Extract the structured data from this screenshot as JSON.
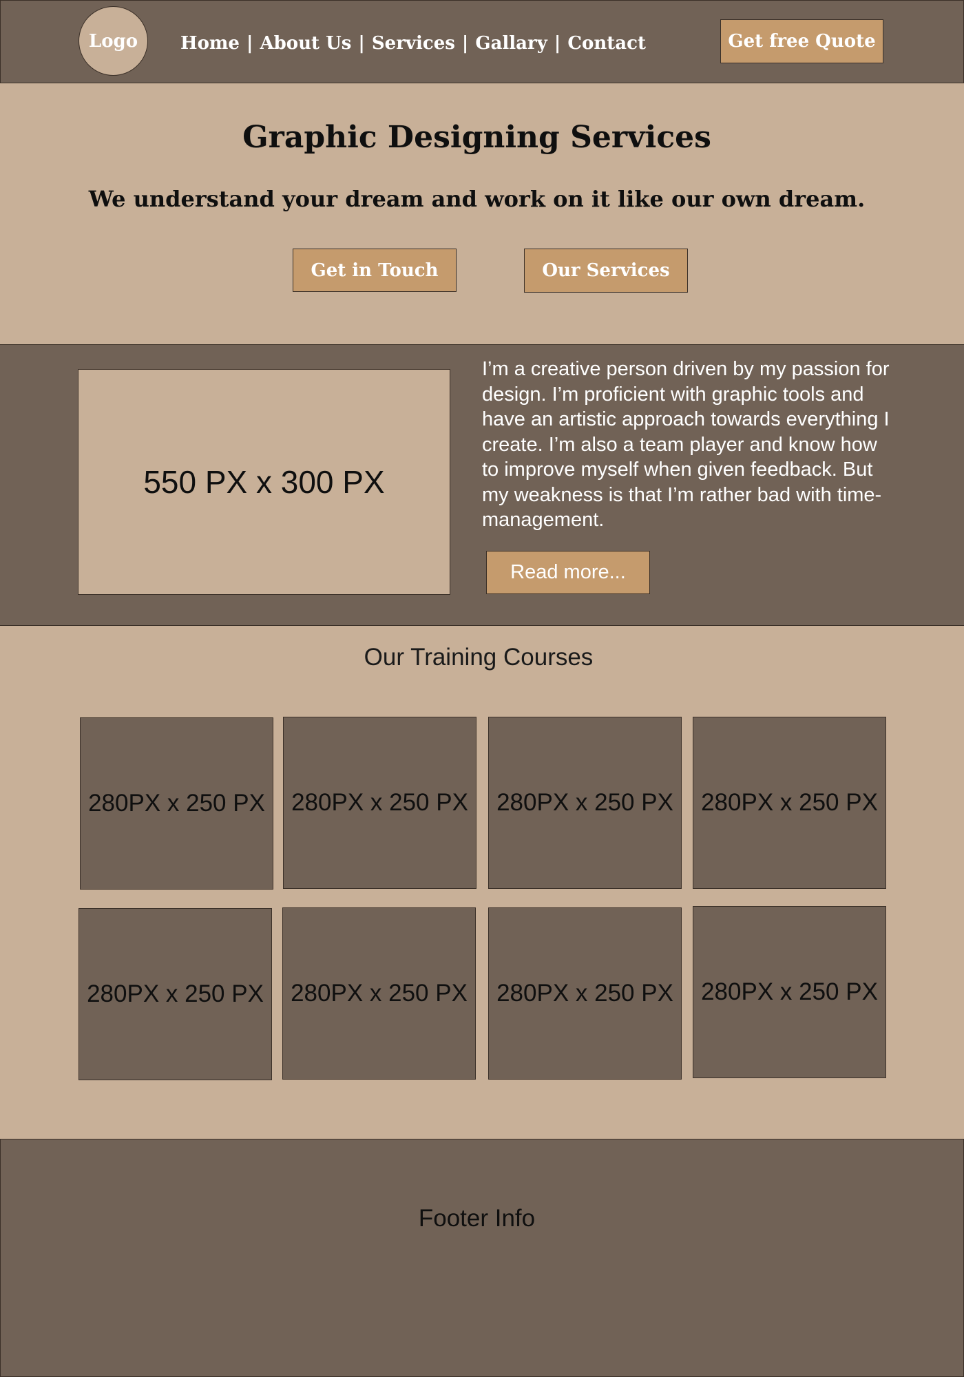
{
  "header": {
    "logo_label": "Logo",
    "nav": [
      {
        "label": "Home"
      },
      {
        "label": "About Us"
      },
      {
        "label": "Services"
      },
      {
        "label": "Gallary"
      },
      {
        "label": "Contact"
      }
    ],
    "nav_separator": "|",
    "quote_button": "Get free Quote"
  },
  "hero": {
    "title": "Graphic Designing Services",
    "subtitle": "We understand your dream and work on it like our own dream.",
    "primary_button": "Get in Touch",
    "secondary_button": "Our Services"
  },
  "about": {
    "image_placeholder": "550 PX x 300 PX",
    "text": "I’m a creative person driven by my passion for design. I’m proficient with graphic tools and have an artistic approach towards everything I create. I’m also a team player and know how to improve myself when given feedback. But my weakness is that I’m rather bad with time-management.",
    "read_more_button": "Read more..."
  },
  "courses": {
    "title": "Our Training Courses",
    "cards": [
      {
        "label": "280PX x 250 PX"
      },
      {
        "label": "280PX x 250 PX"
      },
      {
        "label": "280PX x 250 PX"
      },
      {
        "label": "280PX x 250 PX"
      },
      {
        "label": "280PX x 250 PX"
      },
      {
        "label": "280PX x 250 PX"
      },
      {
        "label": "280PX x 250 PX"
      },
      {
        "label": "280PX x 250 PX"
      }
    ]
  },
  "footer": {
    "text": "Footer Info"
  },
  "colors": {
    "dark_brown": "#716256",
    "light_tan": "#c8b098",
    "button_tan": "#c59b6d",
    "border": "#3b3028",
    "white_text": "#ffffff"
  }
}
